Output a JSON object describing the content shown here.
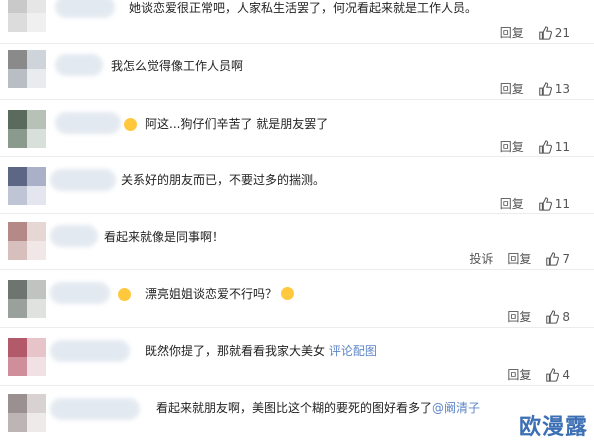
{
  "comments": [
    {
      "text": "她谈恋爱很正常吧，人家私生活罢了，何况看起来就是工作人员。",
      "mention": "",
      "report": "",
      "reply": "回复",
      "likes": "21",
      "avatar": [
        "#c9c9c9",
        "#e6e6e6",
        "#dcdcdc",
        "#f0f0f0"
      ]
    },
    {
      "text": "我怎么觉得像工作人员啊",
      "mention": "",
      "report": "",
      "reply": "回复",
      "likes": "13",
      "avatar": [
        "#8a8a8a",
        "#cfd4da",
        "#b9bec4",
        "#e9ecef"
      ]
    },
    {
      "text": "阿这...狗仔们辛苦了 就是朋友罢了",
      "mention": "",
      "report": "",
      "reply": "回复",
      "likes": "11",
      "avatar": [
        "#5a6a5c",
        "#b7c1b8",
        "#8a9a8c",
        "#d9dfda"
      ]
    },
    {
      "text": "关系好的朋友而已，不要过多的揣测。",
      "mention": "",
      "report": "",
      "reply": "回复",
      "likes": "11",
      "avatar": [
        "#5d6685",
        "#a9b0c8",
        "#c0c5d6",
        "#e3e6ef"
      ]
    },
    {
      "text": "看起来就像是同事啊！",
      "mention": "",
      "report": "投诉",
      "reply": "回复",
      "likes": "7",
      "avatar": [
        "#b58a86",
        "#e6d6d4",
        "#d6bfbc",
        "#f1e7e6"
      ]
    },
    {
      "text": "漂亮姐姐谈恋爱不行吗？",
      "mention": "",
      "report": "",
      "reply": "回复",
      "likes": "8",
      "avatar": [
        "#6e746f",
        "#bfc4c0",
        "#9aa09b",
        "#dfe2df"
      ]
    },
    {
      "text": "既然你提了，那就看看我家大美女 ",
      "mention": "评论配图",
      "report": "",
      "reply": "回复",
      "likes": "4",
      "avatar": [
        "#b25a6a",
        "#e6c4ca",
        "#cf8f9a",
        "#f2e1e4"
      ]
    },
    {
      "text": "看起来就朋友啊，美图比这个糊的要死的图好看多了",
      "mention": "@阚清子",
      "report": "",
      "reply": "",
      "likes": "",
      "avatar": [
        "#9a9090",
        "#d8d2d2",
        "#bdb4b4",
        "#eeeaea"
      ]
    }
  ],
  "watermark": "欧漫露"
}
